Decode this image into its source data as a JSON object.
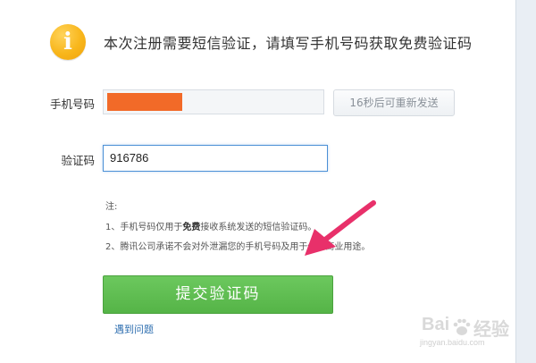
{
  "notice": {
    "text": "本次注册需要短信验证，请填写手机号码获取免费验证码"
  },
  "form": {
    "phone_label": "手机号码",
    "code_label": "验证码",
    "code_value": "916786",
    "resend_label": "16秒后可重新发送"
  },
  "notes": {
    "title": "注:",
    "line1_prefix": "1、手机号码仅用于",
    "line1_bold": "免费",
    "line1_suffix": "接收系统发送的短信验证码。",
    "line2": "2、腾讯公司承诺不会对外泄漏您的手机号码及用于任何商业用途。"
  },
  "submit_label": "提交验证码",
  "help_link": "遇到问题",
  "watermark": {
    "brand": "Bai",
    "brand_cn": "经验",
    "url": "jingyan.baidu.com"
  },
  "colors": {
    "submit": "#5bb94c",
    "info_icon": "#f8b61b",
    "arrow": "#e8306a",
    "link": "#2f6fb0"
  }
}
